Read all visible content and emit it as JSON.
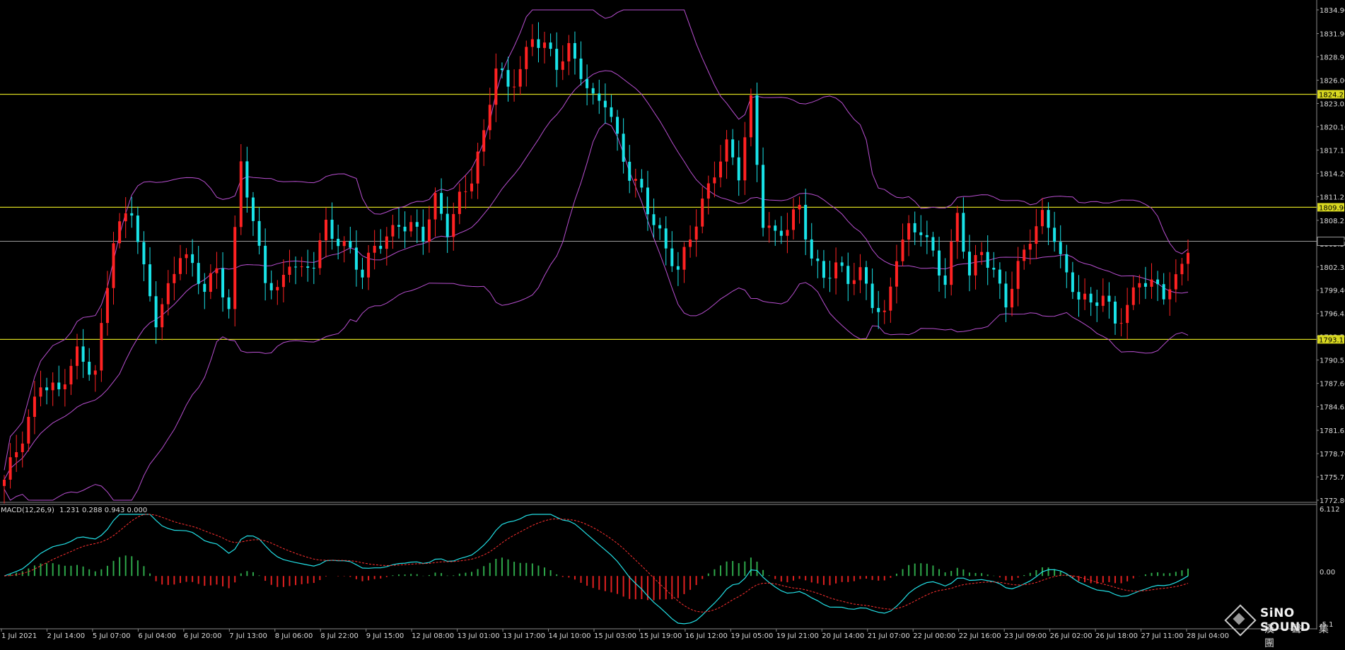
{
  "colors": {
    "background": "#000000",
    "bull_candle": "#ff2222",
    "bear_candle": "#19e3e8",
    "bands": "#b84fd0",
    "support_resistance": "#d8d820",
    "axis_text": "#dcdcdc",
    "macd_line": "#22e0e6",
    "signal_line": "#ff3030",
    "hist_pos": "#2ea84a",
    "hist_neg": "#e02020"
  },
  "chart_data": {
    "type": "candlestick",
    "price_axis": {
      "ylim": [
        1772.8,
        1834.9
      ],
      "ticks": [
        "1834.90",
        "1831.90",
        "1828.95",
        "1826.00",
        "1823.05",
        "1820.10",
        "1817.15",
        "1814.20",
        "1811.25",
        "1808.25",
        "1805.30",
        "1802.35",
        "1799.40",
        "1796.45",
        "1793.50",
        "1790.55",
        "1787.60",
        "1784.65",
        "1781.65",
        "1778.70",
        "1775.75",
        "1772.80"
      ],
      "tick_values": [
        1834.9,
        1831.9,
        1828.95,
        1826.0,
        1823.05,
        1820.1,
        1817.15,
        1814.2,
        1811.25,
        1808.25,
        1805.3,
        1802.35,
        1799.4,
        1796.45,
        1793.5,
        1790.55,
        1787.6,
        1784.65,
        1781.65,
        1778.7,
        1775.75,
        1772.8
      ]
    },
    "horizontal_levels": [
      {
        "label": "1824.21",
        "value": 1824.21,
        "kind": "resistance"
      },
      {
        "label": "1809.90",
        "value": 1809.9,
        "kind": "resistance"
      },
      {
        "label": "1805.59",
        "value": 1805.59,
        "kind": "current"
      },
      {
        "label": "1793.17",
        "value": 1793.17,
        "kind": "support"
      }
    ],
    "time_axis": [
      "1 Jul 2021",
      "2 Jul 14:00",
      "5 Jul 07:00",
      "6 Jul 04:00",
      "6 Jul 20:00",
      "7 Jul 13:00",
      "8 Jul 06:00",
      "8 Jul 22:00",
      "9 Jul 15:00",
      "12 Jul 08:00",
      "13 Jul 01:00",
      "13 Jul 17:00",
      "14 Jul 10:00",
      "15 Jul 03:00",
      "15 Jul 19:00",
      "16 Jul 12:00",
      "19 Jul 05:00",
      "19 Jul 21:00",
      "20 Jul 14:00",
      "21 Jul 07:00",
      "22 Jul 00:00",
      "22 Jul 16:00",
      "23 Jul 09:00",
      "26 Jul 02:00",
      "26 Jul 18:00",
      "27 Jul 11:00",
      "28 Jul 04:00"
    ],
    "close_path": [
      [
        0,
        1774.8
      ],
      [
        3,
        1781.0
      ],
      [
        6,
        1788.2
      ],
      [
        9,
        1786.0
      ],
      [
        12,
        1791.2
      ],
      [
        15,
        1789.5
      ],
      [
        18,
        1805.8
      ],
      [
        21,
        1809.2
      ],
      [
        23,
        1802.0
      ],
      [
        25,
        1796.2
      ],
      [
        27,
        1799.6
      ],
      [
        29,
        1803.7
      ],
      [
        31,
        1801.8
      ],
      [
        33,
        1799.8
      ],
      [
        35,
        1802.6
      ],
      [
        37,
        1797.1
      ],
      [
        39,
        1815.5
      ],
      [
        41,
        1807.2
      ],
      [
        43,
        1801.2
      ],
      [
        45,
        1799.6
      ],
      [
        47,
        1803.4
      ],
      [
        49,
        1801.0
      ],
      [
        51,
        1802.6
      ],
      [
        53,
        1807.8
      ],
      [
        55,
        1806.2
      ],
      [
        57,
        1804.5
      ],
      [
        59,
        1800.7
      ],
      [
        61,
        1804.6
      ],
      [
        63,
        1806.2
      ],
      [
        65,
        1808.5
      ],
      [
        67,
        1807.5
      ],
      [
        69,
        1805.8
      ],
      [
        71,
        1810.4
      ],
      [
        73,
        1807.3
      ],
      [
        75,
        1811.6
      ],
      [
        77,
        1813.8
      ],
      [
        79,
        1818.5
      ],
      [
        81,
        1827.5
      ],
      [
        83,
        1825.2
      ],
      [
        85,
        1828.0
      ],
      [
        87,
        1831.5
      ],
      [
        89,
        1829.8
      ],
      [
        91,
        1827.5
      ],
      [
        93,
        1830.2
      ],
      [
        95,
        1827.6
      ],
      [
        97,
        1823.5
      ],
      [
        99,
        1822.9
      ],
      [
        101,
        1818.0
      ],
      [
        103,
        1814.2
      ],
      [
        105,
        1812.5
      ],
      [
        107,
        1808.0
      ],
      [
        109,
        1804.1
      ],
      [
        111,
        1801.4
      ],
      [
        113,
        1806.5
      ],
      [
        115,
        1811.0
      ],
      [
        117,
        1814.5
      ],
      [
        119,
        1817.1
      ],
      [
        121,
        1813.8
      ],
      [
        123,
        1823.5
      ],
      [
        125,
        1808.7
      ],
      [
        127,
        1806.3
      ],
      [
        129,
        1807.0
      ],
      [
        131,
        1809.5
      ],
      [
        133,
        1803.8
      ],
      [
        135,
        1801.7
      ],
      [
        137,
        1802.6
      ],
      [
        139,
        1800.2
      ],
      [
        141,
        1801.2
      ],
      [
        143,
        1798.3
      ],
      [
        145,
        1796.5
      ],
      [
        147,
        1804.0
      ],
      [
        149,
        1806.5
      ],
      [
        151,
        1806.7
      ],
      [
        153,
        1804.2
      ],
      [
        155,
        1801.0
      ],
      [
        157,
        1809.1
      ],
      [
        159,
        1800.6
      ],
      [
        161,
        1804.2
      ],
      [
        163,
        1801.8
      ],
      [
        165,
        1798.5
      ],
      [
        167,
        1802.3
      ],
      [
        169,
        1805.6
      ],
      [
        171,
        1808.3
      ],
      [
        173,
        1806.7
      ],
      [
        175,
        1801.5
      ],
      [
        177,
        1798.8
      ],
      [
        179,
        1796.9
      ],
      [
        181,
        1798.5
      ],
      [
        183,
        1795.6
      ],
      [
        185,
        1797.8
      ],
      [
        187,
        1800.8
      ],
      [
        189,
        1799.5
      ],
      [
        191,
        1798.7
      ],
      [
        193,
        1800.9
      ],
      [
        195,
        1805.6
      ]
    ],
    "indicator": {
      "name": "MACD(12,26,9)",
      "readout": "1.231 0.288 0.943 0.000",
      "axis": {
        "top": "6.112",
        "zero": "0.00",
        "bottom": "-5.1"
      },
      "ylim": [
        -5.1,
        6.112
      ]
    },
    "watermark": "SiNO SOUND",
    "watermark_cn": "漢 聲 集 團"
  }
}
